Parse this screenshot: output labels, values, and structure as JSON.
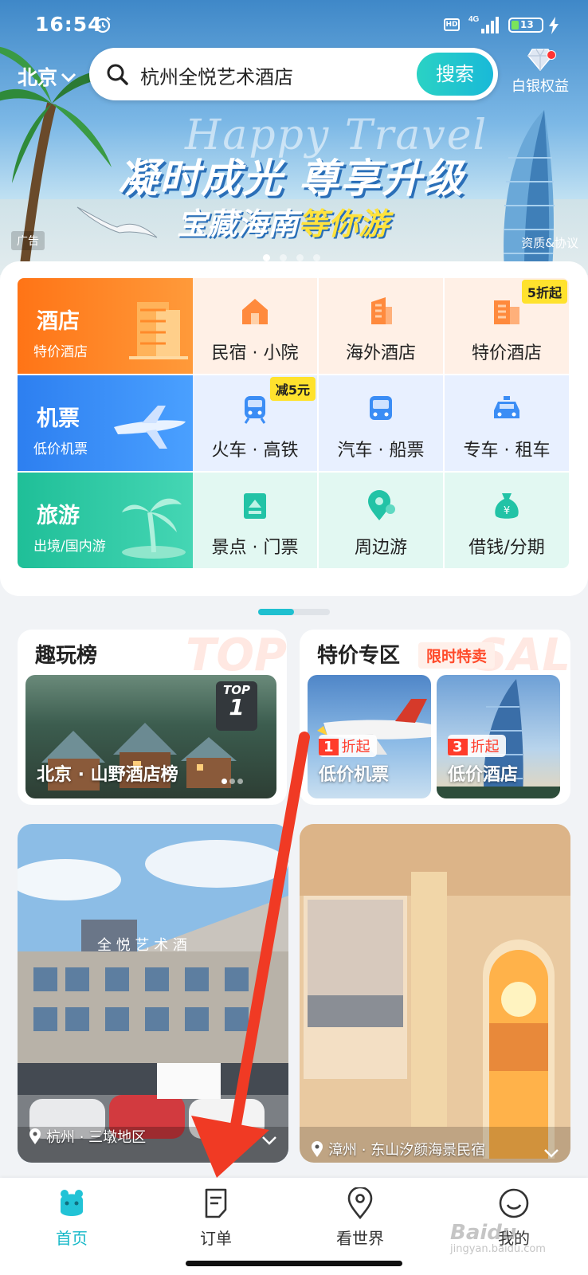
{
  "status_bar": {
    "time": "16:54",
    "network": "4G",
    "hd": "HD",
    "battery": "13"
  },
  "header": {
    "city": "北京",
    "search_text": "杭州全悦艺术酒店",
    "search_button": "搜索",
    "vip_label": "白银权益"
  },
  "banner": {
    "slogan_en": "Happy Travel",
    "slogan_main": "凝时成光 尊享升级",
    "slogan_sub_a": "宝藏海南",
    "slogan_sub_b": "等你游",
    "ad_tag": "广告",
    "qualification": "资质&协议",
    "page_count": 4,
    "page_active": 1
  },
  "categories": {
    "big": [
      {
        "title": "酒店",
        "sub": "特价酒店",
        "color": "#ff7a1a"
      },
      {
        "title": "机票",
        "sub": "低价机票",
        "color": "#2f86f2"
      },
      {
        "title": "旅游",
        "sub": "出境/国内游",
        "color": "#21c2a0"
      }
    ],
    "row1": [
      {
        "label": "民宿 · 小院",
        "icon": "house-icon"
      },
      {
        "label": "海外酒店",
        "icon": "overseas-hotel-icon"
      },
      {
        "label": "特价酒店",
        "icon": "discount-hotel-icon",
        "badge": "5折起"
      }
    ],
    "row2": [
      {
        "label": "火车 · 高铁",
        "icon": "train-icon",
        "badge": "减5元"
      },
      {
        "label": "汽车 · 船票",
        "icon": "bus-icon"
      },
      {
        "label": "专车 · 租车",
        "icon": "car-icon"
      }
    ],
    "row3": [
      {
        "label": "景点 · 门票",
        "icon": "ticket-icon"
      },
      {
        "label": "周边游",
        "icon": "location-icon"
      },
      {
        "label": "借钱/分期",
        "icon": "money-bag-icon"
      }
    ]
  },
  "fun_list": {
    "title": "趣玩榜",
    "bg_word": "TOP",
    "caption": "北京 · 山野酒店榜",
    "top_label": "TOP",
    "top_rank": "1"
  },
  "special": {
    "title": "特价专区",
    "tag": "限时特卖",
    "bg_word": "SAL",
    "cards": [
      {
        "discount_num": "1",
        "discount_text": "折起",
        "caption": "低价机票"
      },
      {
        "discount_num": "3",
        "discount_text": "折起",
        "caption": "低价酒店"
      }
    ]
  },
  "feed": [
    {
      "city": "杭州",
      "place": "三墩地区",
      "sign_text": "全 悦 艺 术 酒"
    },
    {
      "city": "漳州",
      "place": "东山汐颜海景民宿"
    }
  ],
  "nav": [
    {
      "label": "首页",
      "icon": "home-icon"
    },
    {
      "label": "订单",
      "icon": "order-icon"
    },
    {
      "label": "看世界",
      "icon": "explore-icon"
    },
    {
      "label": "我的",
      "icon": "profile-icon"
    }
  ],
  "watermark": {
    "brand": "Baidu",
    "sub": "jingyan.baidu.com"
  },
  "colors": {
    "accent": "#16b8c8",
    "arrow": "#f03a24",
    "badge": "#ffe22d"
  }
}
